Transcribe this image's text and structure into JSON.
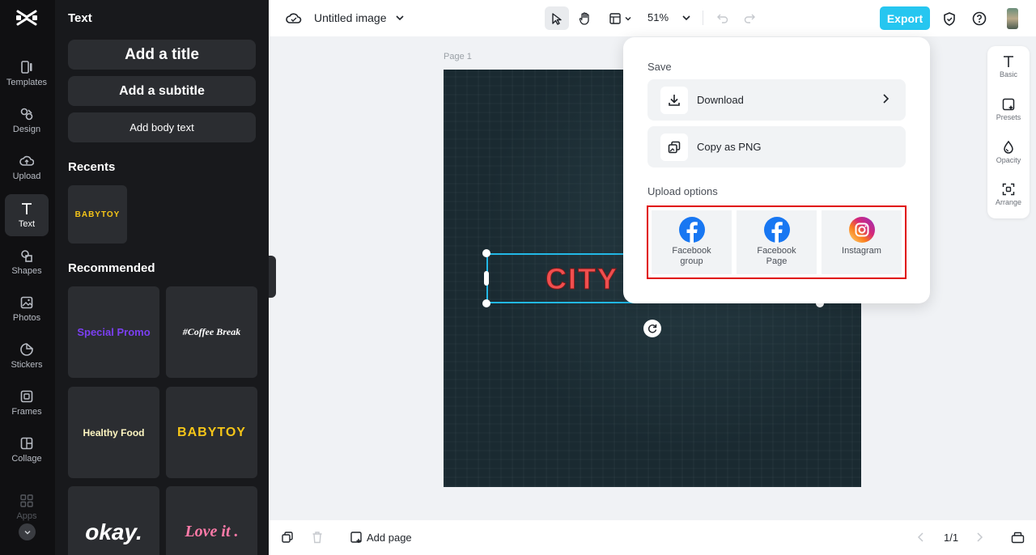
{
  "rail": {
    "items": [
      {
        "label": "Templates"
      },
      {
        "label": "Design"
      },
      {
        "label": "Upload"
      },
      {
        "label": "Text"
      },
      {
        "label": "Shapes"
      },
      {
        "label": "Photos"
      },
      {
        "label": "Stickers"
      },
      {
        "label": "Frames"
      },
      {
        "label": "Collage"
      },
      {
        "label": "Apps"
      }
    ]
  },
  "panel": {
    "title": "Text",
    "add_title": "Add a title",
    "add_subtitle": "Add a subtitle",
    "add_body": "Add body text",
    "recents_title": "Recents",
    "recents": [
      "BABYTOY"
    ],
    "recommended_title": "Recommended",
    "recommended": [
      "Special Promo",
      "#Coffee Break",
      "Healthy Food",
      "BABYTOY",
      "okay.",
      "Love it ."
    ]
  },
  "topbar": {
    "doc_title": "Untitled image",
    "zoom": "51%",
    "export_label": "Export"
  },
  "canvas": {
    "page_label": "Page 1",
    "text": "CITY"
  },
  "right_toolbar": {
    "items": [
      {
        "label": "Basic"
      },
      {
        "label": "Presets"
      },
      {
        "label": "Opacity"
      },
      {
        "label": "Arrange"
      }
    ]
  },
  "export_menu": {
    "save_label": "Save",
    "download_label": "Download",
    "copy_label": "Copy as PNG",
    "upload_label": "Upload options",
    "upload_targets": [
      {
        "line1": "Facebook",
        "line2": "group"
      },
      {
        "line1": "Facebook",
        "line2": "Page"
      },
      {
        "line1": "Instagram",
        "line2": ""
      }
    ]
  },
  "bottombar": {
    "add_page_label": "Add page",
    "page_count": "1/1"
  },
  "colors": {
    "accent": "#26c6f0",
    "selection": "#22b8e6",
    "highlight_border": "#e00000",
    "facebook": "#1877f2"
  }
}
